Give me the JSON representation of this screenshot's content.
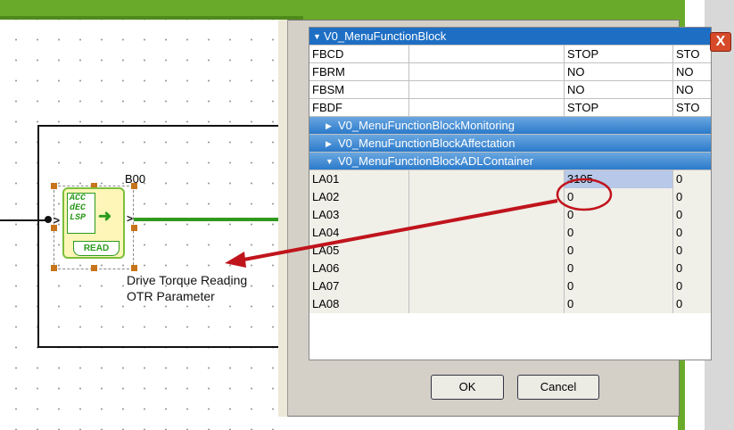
{
  "canvas": {
    "block_id": "B00",
    "block_icon_lines": [
      "ACC",
      "dEC",
      "LSP"
    ],
    "block_caption": "READ",
    "block_desc_line1": "Drive Torque Reading",
    "block_desc_line2": "OTR Parameter"
  },
  "grid": {
    "header": "V0_MenuFunctionBlock",
    "top_rows": [
      {
        "name": "FBCD",
        "value": "STOP",
        "extra": "STO"
      },
      {
        "name": "FBRM",
        "value": "NO",
        "extra": "NO"
      },
      {
        "name": "FBSM",
        "value": "NO",
        "extra": "NO"
      },
      {
        "name": "FBDF",
        "value": "STOP",
        "extra": "STO"
      }
    ],
    "groups": [
      {
        "label": "V0_MenuFunctionBlockMonitoring",
        "state": "collapsed"
      },
      {
        "label": "V0_MenuFunctionBlockAffectation",
        "state": "collapsed"
      },
      {
        "label": "V0_MenuFunctionBlockADLContainer",
        "state": "expanded"
      }
    ],
    "adl_rows": [
      {
        "name": "LA01",
        "value": "3105",
        "extra": "0"
      },
      {
        "name": "LA02",
        "value": "0",
        "extra": "0"
      },
      {
        "name": "LA03",
        "value": "0",
        "extra": "0"
      },
      {
        "name": "LA04",
        "value": "0",
        "extra": "0"
      },
      {
        "name": "LA05",
        "value": "0",
        "extra": "0"
      },
      {
        "name": "LA06",
        "value": "0",
        "extra": "0"
      },
      {
        "name": "LA07",
        "value": "0",
        "extra": "0"
      },
      {
        "name": "LA08",
        "value": "0",
        "extra": "0"
      }
    ]
  },
  "buttons": {
    "ok": "OK",
    "cancel": "Cancel",
    "close": "X"
  },
  "colors": {
    "annotation_red": "#c0141c",
    "wire_green": "#2f9a1e",
    "header_blue": "#1e6fc4"
  }
}
